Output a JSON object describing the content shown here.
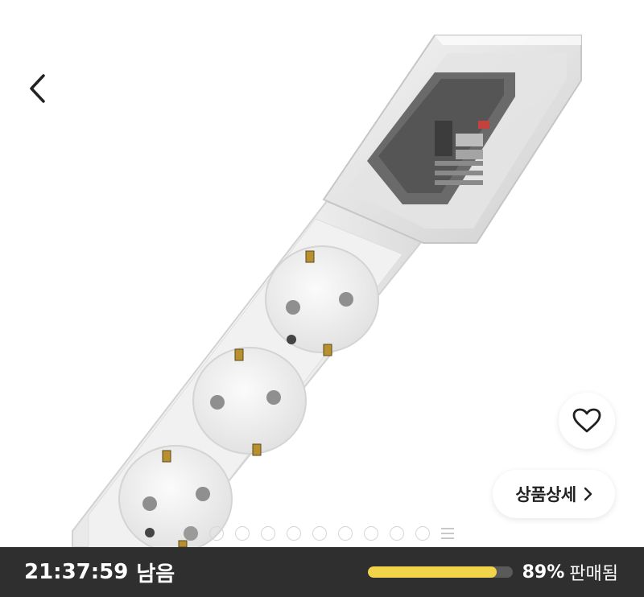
{
  "product": {
    "image_alt": "power strip with three sockets and a clear cover",
    "detail_button_label": "상품상세"
  },
  "icons": {
    "back": "chevron-left-icon",
    "like": "heart-outline-icon",
    "detail": "chevron-right-icon",
    "pager_overview": "grid-icon"
  },
  "pager": {
    "total_dots": 10,
    "active_index": 0
  },
  "deal": {
    "time_remaining": "21:37:59",
    "time_suffix": "남음",
    "sold_percent": 89,
    "sold_percent_label": "89%",
    "sold_suffix": "판매됨"
  },
  "colors": {
    "bottom_bar": "#2f2f2f",
    "progress_fill": "#f2d44a",
    "progress_track": "#5a5a5a"
  }
}
